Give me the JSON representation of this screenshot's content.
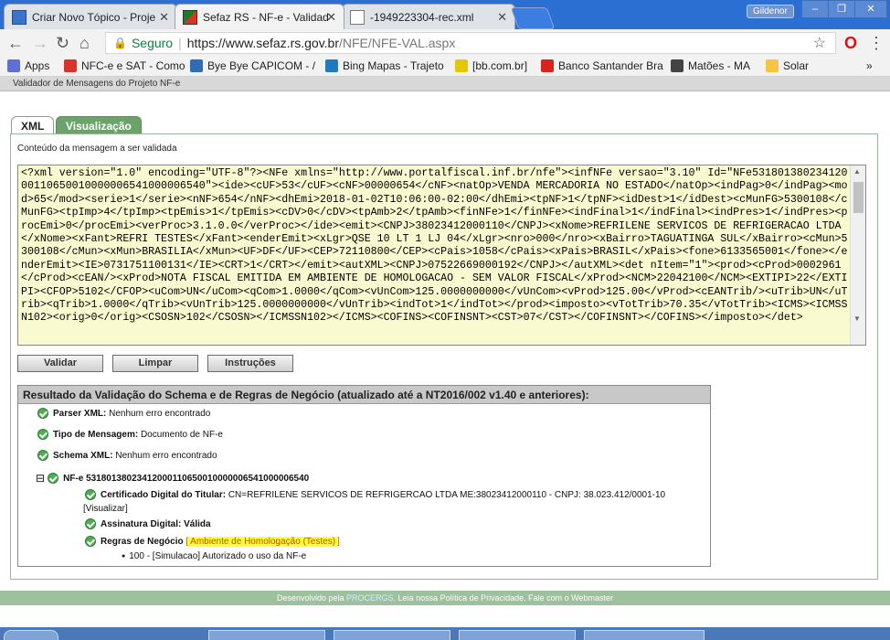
{
  "browser": {
    "tabs": [
      {
        "title": "Criar Novo Tópico - Proje",
        "icon": "forum-icon"
      },
      {
        "title": "Sefaz RS - NF-e - Validad",
        "icon": "sefaz-icon"
      },
      {
        "title": "-1949223304-rec.xml",
        "icon": "document-icon"
      }
    ],
    "profile_name": "Gildenor",
    "address": {
      "secure_label": "Seguro",
      "url_host": "https://www.sefaz.rs.gov.br",
      "url_path": "/NFE/NFE-VAL.aspx"
    },
    "bookmarks": [
      {
        "label": "Apps",
        "color": "#5f6fd6"
      },
      {
        "label": "NFC-e e SAT - Como",
        "color": "#d9342b"
      },
      {
        "label": "Bye Bye CAPICOM - /",
        "color": "#2f6db5"
      },
      {
        "label": "Bing Mapas - Trajeto",
        "color": "#1e7bc1"
      },
      {
        "label": "[bb.com.br]",
        "color": "#e5c700"
      },
      {
        "label": "Banco Santander Bra",
        "color": "#d9231b"
      },
      {
        "label": "Matões - MA",
        "color": "#444444"
      },
      {
        "label": "Solar",
        "color": "#f5c542"
      }
    ],
    "bookmarks_more": "»"
  },
  "page": {
    "header_title": "Validador de Mensagens do Projeto NF-e",
    "tabs": [
      "XML",
      "Visualização"
    ],
    "content_label": "Conteúdo da mensagem a ser validada",
    "xml_content": "<?xml version=\"1.0\" encoding=\"UTF-8\"?><NFe xmlns=\"http://www.portalfiscal.inf.br/nfe\"><infNFe versao=\"3.10\" Id=\"NFe53180138023412000110650010000006541000006540\"><ide><cUF>53</cUF><cNF>00000654</cNF><natOp>VENDA MERCADORIA NO ESTADO</natOp><indPag>0</indPag><mod>65</mod><serie>1</serie><nNF>654</nNF><dhEmi>2018-01-02T10:06:00-02:00</dhEmi><tpNF>1</tpNF><idDest>1</idDest><cMunFG>5300108</cMunFG><tpImp>4</tpImp><tpEmis>1</tpEmis><cDV>0</cDV><tpAmb>2</tpAmb><finNFe>1</finNFe><indFinal>1</indFinal><indPres>1</indPres><procEmi>0</procEmi><verProc>3.1.0.0</verProc></ide><emit><CNPJ>38023412000110</CNPJ><xNome>REFRILENE SERVICOS DE REFRIGERACAO LTDA</xNome><xFant>REFRI TESTES</xFant><enderEmit><xLgr>QSE 10 LT 1 LJ 04</xLgr><nro>000</nro><xBairro>TAGUATINGA SUL</xBairro><cMun>5300108</cMun><xMun>BRASILIA</xMun><UF>DF</UF><CEP>72110800</CEP><cPais>1058</cPais><xPais>BRASIL</xPais><fone>6133565001</fone></enderEmit><IE>0731751100131</IE><CRT>1</CRT></emit><autXML><CNPJ>07522669000192</CNPJ></autXML><det nItem=\"1\"><prod><cProd>0002961</cProd><cEAN/><xProd>NOTA FISCAL EMITIDA EM AMBIENTE DE HOMOLOGACAO - SEM VALOR FISCAL</xProd><NCM>22042100</NCM><EXTIPI>22</EXTIPI><CFOP>5102</CFOP><uCom>UN</uCom><qCom>1.0000</qCom><vUnCom>125.0000000000</vUnCom><vProd>125.00</vProd><cEANTrib/><uTrib>UN</uTrib><qTrib>1.0000</qTrib><vUnTrib>125.0000000000</vUnTrib><indTot>1</indTot></prod><imposto><vTotTrib>70.35</vTotTrib><ICMS><ICMSSN102><orig>0</orig><CSOSN>102</CSOSN></ICMSSN102></ICMS><COFINS><COFINSNT><CST>07</CST></COFINSNT></COFINS></imposto></det>",
    "buttons": {
      "validar": "Validar",
      "limpar": "Limpar",
      "instrucoes": "Instruções"
    },
    "result": {
      "title": "Resultado da Validação do Schema e de Regras de Negócio (atualizado até a NT2016/002 v1.40 e anteriores):",
      "parser_label": "Parser XML:",
      "parser_value": "Nenhum erro encontrado",
      "tipo_label": "Tipo de Mensagem:",
      "tipo_value": "Documento de NF-e",
      "schema_label": "Schema XML:",
      "schema_value": "Nenhum erro encontrado",
      "tree_toggle": "⊟",
      "nfe_label": "NF-e 53180138023412000110650010000006541000006540",
      "cert_label": "Certificado Digital do Titular:",
      "cert_value": "CN=REFRILENE SERVICOS DE REFRIGERCAO LTDA ME:38023412000110 - CNPJ: 38.023.412/0001-10",
      "visualizar": "[Visualizar]",
      "assinatura_label": "Assinatura Digital:",
      "assinatura_value": "Válida",
      "regras_label": "Regras de Negócio",
      "regras_open": "[",
      "regras_value": "Ambiente de Homologação (Testes)",
      "regras_close": "]",
      "bullet": "●",
      "status_msg": "100 - [Simulacao] Autorizado o uso da NF-e"
    },
    "footer": {
      "prefix": "Desenvolvido pela",
      "procergs": "PROCERGS",
      "privacy": "Leia nossa Política de Privacidade.",
      "webmaster": "Fale com o Webmaster"
    }
  }
}
